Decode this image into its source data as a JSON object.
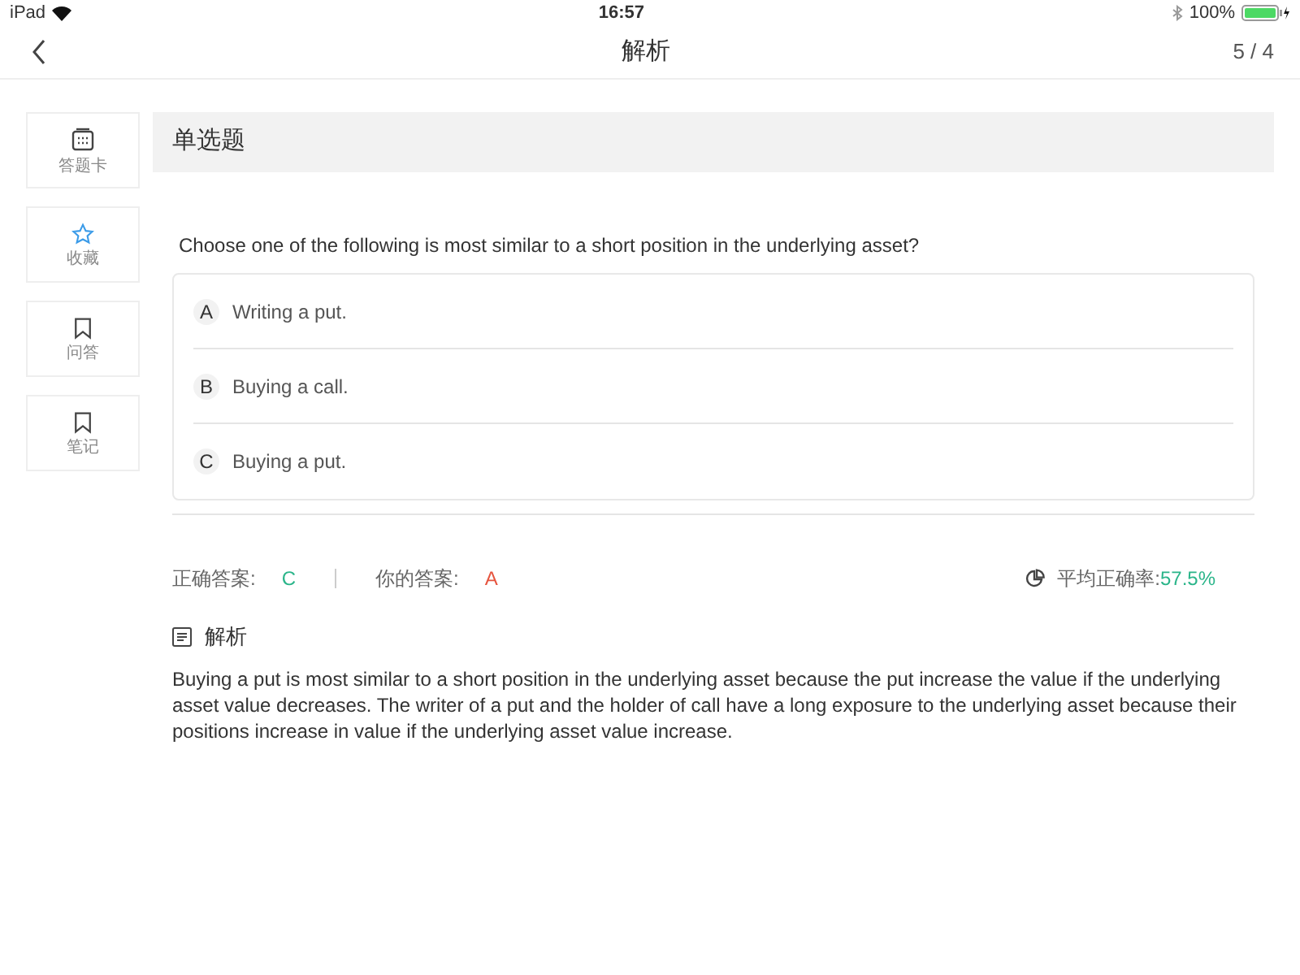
{
  "status_bar": {
    "device": "iPad",
    "time": "16:57",
    "battery": "100%"
  },
  "nav": {
    "title": "解析",
    "progress": "5 / 4"
  },
  "sidebar": {
    "items": [
      {
        "kind": "card",
        "label": "答题卡"
      },
      {
        "kind": "star",
        "label": "收藏"
      },
      {
        "kind": "bookmark",
        "label": "问答"
      },
      {
        "kind": "bookmark",
        "label": "笔记"
      }
    ]
  },
  "question": {
    "type": "单选题",
    "text": "Choose one of the following is most similar to a short position in the underlying asset?",
    "options": [
      {
        "letter": "A",
        "text": "Writing a put."
      },
      {
        "letter": "B",
        "text": "Buying a call."
      },
      {
        "letter": "C",
        "text": "Buying a put."
      }
    ]
  },
  "result": {
    "correct_label": "正确答案:",
    "correct": "C",
    "yours_label": "你的答案:",
    "yours": "A",
    "rate_label": "平均正确率:",
    "rate": "57.5%"
  },
  "explanation": {
    "title": "解析",
    "text": "Buying a put is most similar to a short position in the underlying asset because the put increase the value if the underlying asset value decreases. The writer of a put and the holder of call have a long exposure to the underlying asset because their positions increase in value if the underlying asset value increase."
  }
}
